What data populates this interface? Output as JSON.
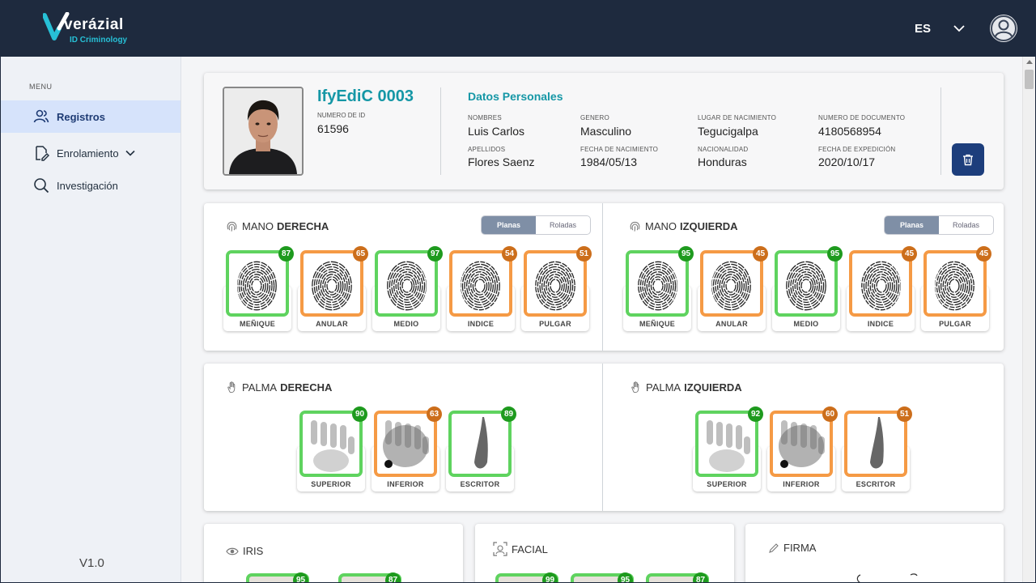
{
  "header": {
    "brand": "verázial",
    "brand_sub": "ID Criminology",
    "language": "ES",
    "colors": {
      "bar": "#1e2a3e",
      "accent": "#27c0d6"
    }
  },
  "sidebar": {
    "menu_label": "MENU",
    "items": [
      {
        "label": "Registros",
        "icon": "users-icon",
        "active": true
      },
      {
        "label": "Enrolamiento",
        "icon": "edit-document-icon",
        "active": false
      },
      {
        "label": "Investigación",
        "icon": "search-icon",
        "active": false
      }
    ],
    "version": "V1.0"
  },
  "record": {
    "title": "IfyEdiC 0003",
    "id_label": "NUMERO DE ID",
    "id_value": "61596",
    "section_title": "Datos Personales",
    "fields": [
      {
        "label": "NOMBRES",
        "value": "Luis Carlos"
      },
      {
        "label": "GENERO",
        "value": "Masculino"
      },
      {
        "label": "LUGAR DE NACIMIENTO",
        "value": "Tegucigalpa"
      },
      {
        "label": "NUMERO DE DOCUMENTO",
        "value": "4180568954"
      },
      {
        "label": "APELLIDOS",
        "value": "Flores Saenz"
      },
      {
        "label": "FECHA DE NACIMIENTO",
        "value": "1984/05/13"
      },
      {
        "label": "NACIONALIDAD",
        "value": "Honduras"
      },
      {
        "label": "FECHA DE EXPEDICIÓN",
        "value": "2020/10/17"
      }
    ]
  },
  "hands": {
    "right": {
      "title_prefix": "MANO",
      "title_bold": "DERECHA",
      "toggle": [
        "Planas",
        "Roladas"
      ],
      "fingers": [
        {
          "label": "MEÑIQUE",
          "score": "87",
          "status": "green"
        },
        {
          "label": "ANULAR",
          "score": "65",
          "status": "orange"
        },
        {
          "label": "MEDIO",
          "score": "97",
          "status": "green"
        },
        {
          "label": "INDICE",
          "score": "54",
          "status": "orange"
        },
        {
          "label": "PULGAR",
          "score": "51",
          "status": "orange"
        }
      ]
    },
    "left": {
      "title_prefix": "MANO",
      "title_bold": "IZQUIERDA",
      "toggle": [
        "Planas",
        "Roladas"
      ],
      "fingers": [
        {
          "label": "MEÑIQUE",
          "score": "95",
          "status": "green"
        },
        {
          "label": "ANULAR",
          "score": "45",
          "status": "orange"
        },
        {
          "label": "MEDIO",
          "score": "95",
          "status": "green"
        },
        {
          "label": "INDICE",
          "score": "45",
          "status": "orange"
        },
        {
          "label": "PULGAR",
          "score": "45",
          "status": "orange"
        }
      ]
    }
  },
  "palms": {
    "right": {
      "title_prefix": "PALMA",
      "title_bold": "DERECHA",
      "items": [
        {
          "label": "SUPERIOR",
          "score": "90",
          "status": "green"
        },
        {
          "label": "INFERIOR",
          "score": "63",
          "status": "orange"
        },
        {
          "label": "ESCRITOR",
          "score": "89",
          "status": "green"
        }
      ]
    },
    "left": {
      "title_prefix": "PALMA",
      "title_bold": "IZQUIERDA",
      "items": [
        {
          "label": "SUPERIOR",
          "score": "92",
          "status": "green"
        },
        {
          "label": "INFERIOR",
          "score": "60",
          "status": "orange"
        },
        {
          "label": "ESCRITOR",
          "score": "51",
          "status": "orange"
        }
      ]
    }
  },
  "bottom": {
    "iris": {
      "title": "IRIS",
      "scores": [
        "95",
        "87"
      ]
    },
    "facial": {
      "title": "FACIAL",
      "scores": [
        "99",
        "95",
        "87"
      ]
    },
    "firma": {
      "title": "FIRMA"
    }
  }
}
